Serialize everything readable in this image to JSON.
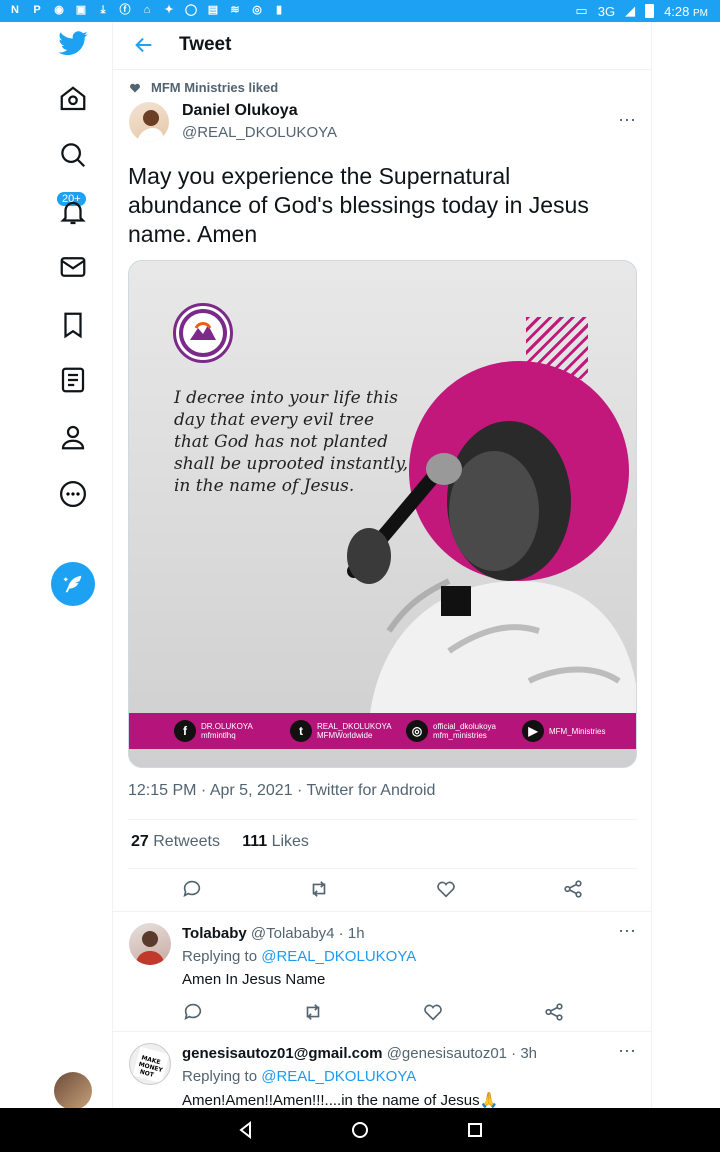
{
  "status_bar": {
    "left_icons": [
      "N",
      "P",
      "G",
      "D",
      "download",
      "fb",
      "mail",
      "tw",
      "wa",
      "msg",
      "speed",
      "ig",
      "lock"
    ],
    "network": "3G",
    "time": "4:28",
    "ampm": "PM"
  },
  "sidebar": {
    "notification_badge": "20+"
  },
  "header": {
    "title": "Tweet"
  },
  "tweet": {
    "liked_by": "MFM Ministries liked",
    "author_name": "Daniel Olukoya",
    "author_handle": "@REAL_DKOLUKOYA",
    "text": "May you experience the Supernatural abundance of God's blessings today in Jesus name. Amen",
    "image": {
      "quote": "I decree into your life this day that every evil tree that God has not planted shall be uprooted instantly, in the name of Jesus.",
      "banner": [
        {
          "icon": "f",
          "line1": "DR.OLUKOYA",
          "line2": "mfmintlhq"
        },
        {
          "icon": "t",
          "line1": "REAL_DKOLUKOYA",
          "line2": "MFMWorldwide"
        },
        {
          "icon": "◎",
          "line1": "official_dkolukoya",
          "line2": "mfm_ministries"
        },
        {
          "icon": "▶",
          "line1": "MFM_Ministries",
          "line2": ""
        }
      ]
    },
    "timestamp": "12:15 PM · Apr 5, 2021 · Twitter for Android",
    "retweets_count": "27",
    "retweets_label": "Retweets",
    "likes_count": "111",
    "likes_label": "Likes"
  },
  "replies": [
    {
      "name": "Tolababy",
      "handle_time": "@Tolababy4 · 1h",
      "replying_prefix": "Replying to ",
      "replying_to": "@REAL_DKOLUKOYA",
      "body": "Amen In Jesus Name"
    },
    {
      "name": "genesisautoz01@gmail.com",
      "handle_time": "@genesisautoz01 · 3h",
      "replying_prefix": "Replying to ",
      "replying_to": "@REAL_DKOLUKOYA",
      "body": "Amen!Amen!!Amen!!!....in the name of Jesus🙏",
      "avatar_text": "MAKE MONEY NOT FRIENDS"
    }
  ],
  "colors": {
    "accent": "#1da1f2",
    "link": "#1d9bf0",
    "muted": "#536471",
    "magenta": "#c2187b"
  }
}
